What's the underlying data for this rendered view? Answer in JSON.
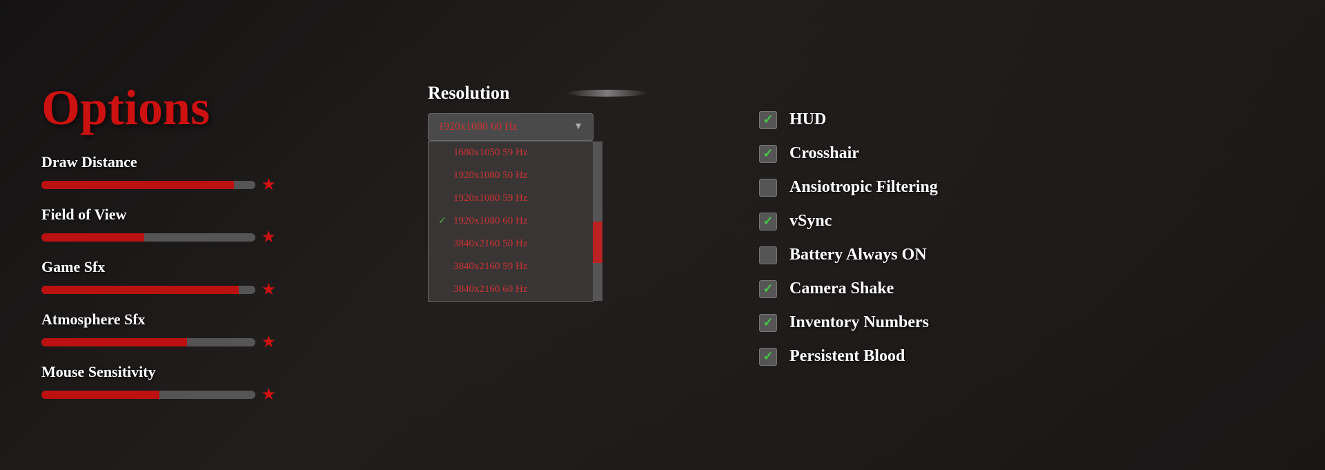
{
  "title": "Options",
  "sliders": [
    {
      "label": "Draw Distance",
      "fill_pct": 90,
      "star": true
    },
    {
      "label": "Field of View",
      "fill_pct": 48,
      "star": true
    },
    {
      "label": "Game Sfx",
      "fill_pct": 92,
      "star": true
    },
    {
      "label": "Atmosphere Sfx",
      "fill_pct": 68,
      "star": true
    },
    {
      "label": "Mouse Sensitivity",
      "fill_pct": 55,
      "star": true
    }
  ],
  "resolution": {
    "title": "Resolution",
    "selected": "1920x1080 60 Hz",
    "options": [
      {
        "label": "1680x1050 59 Hz",
        "selected": false
      },
      {
        "label": "1920x1080 50 Hz",
        "selected": false
      },
      {
        "label": "1920x1080 59 Hz",
        "selected": false
      },
      {
        "label": "1920x1080 60 Hz",
        "selected": true
      },
      {
        "label": "3840x2160 50 Hz",
        "selected": false
      },
      {
        "label": "3840x2160 59 Hz",
        "selected": false
      },
      {
        "label": "3840x2160 60 Hz",
        "selected": false
      }
    ]
  },
  "checkboxes": [
    {
      "label": "HUD",
      "checked": true
    },
    {
      "label": "Crosshair",
      "checked": true
    },
    {
      "label": "Ansiotropic Filtering",
      "checked": false
    },
    {
      "label": "vSync",
      "checked": true
    },
    {
      "label": "Battery Always ON",
      "checked": false
    },
    {
      "label": "Camera Shake",
      "checked": true
    },
    {
      "label": "Inventory Numbers",
      "checked": true
    },
    {
      "label": "Persistent Blood",
      "checked": true
    }
  ],
  "icons": {
    "dropdown_arrow": "▼",
    "check": "✓",
    "star": "★"
  }
}
